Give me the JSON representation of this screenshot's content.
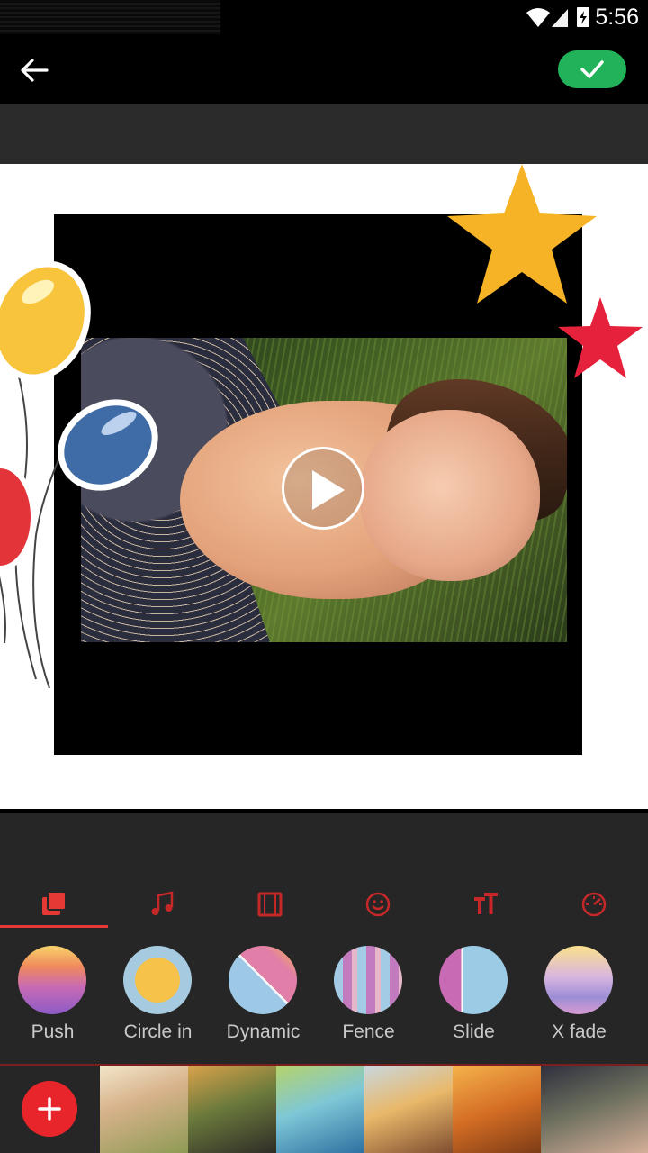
{
  "status_bar": {
    "time": "5:56",
    "icons": [
      "wifi-icon",
      "signal-icon",
      "battery-charging-icon"
    ]
  },
  "toolbar": {
    "back_icon": "arrow-left-icon",
    "confirm_icon": "check-icon",
    "confirm_color": "#22b35a"
  },
  "preview": {
    "play_icon": "play-icon",
    "stickers": [
      "balloons-sticker",
      "yellow-star-sticker",
      "red-star-sticker"
    ]
  },
  "tabs": [
    {
      "icon": "layers-icon",
      "active": true
    },
    {
      "icon": "music-note-icon",
      "active": false
    },
    {
      "icon": "film-strip-icon",
      "active": false
    },
    {
      "icon": "smiley-icon",
      "active": false
    },
    {
      "icon": "text-size-icon",
      "active": false
    },
    {
      "icon": "speedometer-icon",
      "active": false
    }
  ],
  "transitions": [
    {
      "label": "Push"
    },
    {
      "label": "Circle in"
    },
    {
      "label": "Dynamic"
    },
    {
      "label": "Fence"
    },
    {
      "label": "Slide"
    },
    {
      "label": "X fade"
    }
  ],
  "clips": {
    "add_icon": "plus-icon",
    "count": 6
  },
  "colors": {
    "accent": "#e53935",
    "panel": "#262626",
    "label": "#c9c9c9"
  }
}
